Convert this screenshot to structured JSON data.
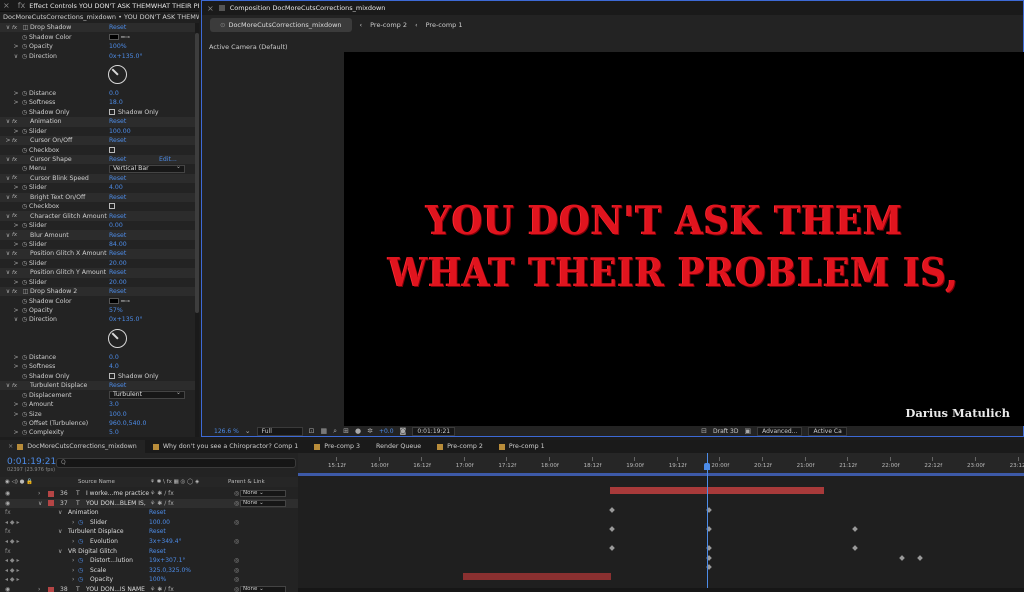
{
  "effect_controls": {
    "tab_title": "Effect Controls YOU DON'T ASK THEMWHAT THEIR PRC",
    "subtitle": "DocMoreCutsCorrections_mixdown • YOU DON'T ASK THEMWHAT THEIR PR",
    "reset": "Reset",
    "edit": "Edit...",
    "rows": [
      {
        "kind": "hdr",
        "tw": "∨",
        "fx": "fx",
        "sw": "◫",
        "name": "Drop Shadow",
        "value": "Reset"
      },
      {
        "kind": "prop",
        "sw": "◷",
        "name": "Shadow Color",
        "color": true
      },
      {
        "kind": "prop",
        "tw": ">",
        "sw": "◷",
        "name": "Opacity",
        "value": "100%"
      },
      {
        "kind": "prop",
        "tw": "∨",
        "sw": "◷",
        "name": "Direction",
        "value": "0x+135.0°"
      },
      {
        "kind": "dial"
      },
      {
        "kind": "prop",
        "tw": ">",
        "sw": "◷",
        "name": "Distance",
        "value": "0.0"
      },
      {
        "kind": "prop",
        "tw": ">",
        "sw": "◷",
        "name": "Softness",
        "value": "18.0"
      },
      {
        "kind": "prop",
        "sw": "◷",
        "name": "Shadow Only",
        "check": "Shadow Only"
      },
      {
        "kind": "hdr",
        "tw": "∨",
        "fx": "fx",
        "name": "Animation",
        "value": "Reset"
      },
      {
        "kind": "prop",
        "tw": ">",
        "sw": "◷",
        "name": "Slider",
        "value": "100.00"
      },
      {
        "kind": "hdr",
        "tw": ">",
        "fx": "fx",
        "name": "Cursor On/Off",
        "value": "Reset"
      },
      {
        "kind": "prop",
        "sw": "◷",
        "name": "Checkbox",
        "check": ""
      },
      {
        "kind": "hdr",
        "tw": "∨",
        "fx": "fx",
        "name": "Cursor Shape",
        "value": "Reset",
        "edit": true
      },
      {
        "kind": "prop",
        "sw": "◷",
        "name": "Menu",
        "drop": "Vertical Bar"
      },
      {
        "kind": "hdr",
        "tw": "∨",
        "fx": "fx",
        "name": "Cursor Blink Speed",
        "value": "Reset"
      },
      {
        "kind": "prop",
        "tw": ">",
        "sw": "◷",
        "name": "Slider",
        "value": "4.00"
      },
      {
        "kind": "hdr",
        "tw": "∨",
        "fx": "fx",
        "name": "Bright Text On/Off",
        "value": "Reset"
      },
      {
        "kind": "prop",
        "sw": "◷",
        "name": "Checkbox",
        "check": ""
      },
      {
        "kind": "hdr",
        "tw": "∨",
        "fx": "fx",
        "name": "Character Glitch Amount",
        "value": "Reset"
      },
      {
        "kind": "prop",
        "tw": ">",
        "sw": "◷",
        "name": "Slider",
        "value": "0.00"
      },
      {
        "kind": "hdr",
        "tw": "∨",
        "fx": "fx",
        "name": "Blur Amount",
        "value": "Reset"
      },
      {
        "kind": "prop",
        "tw": ">",
        "sw": "◷",
        "name": "Slider",
        "value": "84.00"
      },
      {
        "kind": "hdr",
        "tw": "∨",
        "fx": "fx",
        "name": "Position Glitch X Amount",
        "value": "Reset"
      },
      {
        "kind": "prop",
        "tw": ">",
        "sw": "◷",
        "name": "Slider",
        "value": "20.00"
      },
      {
        "kind": "hdr",
        "tw": "∨",
        "fx": "fx",
        "name": "Position Glitch Y Amount",
        "value": "Reset"
      },
      {
        "kind": "prop",
        "tw": ">",
        "sw": "◷",
        "name": "Slider",
        "value": "20.00"
      },
      {
        "kind": "hdr",
        "tw": "∨",
        "fx": "fx",
        "sw": "◫",
        "name": "Drop Shadow 2",
        "value": "Reset"
      },
      {
        "kind": "prop",
        "sw": "◷",
        "name": "Shadow Color",
        "color": true
      },
      {
        "kind": "prop",
        "tw": ">",
        "sw": "◷",
        "name": "Opacity",
        "value": "57%"
      },
      {
        "kind": "prop",
        "tw": "∨",
        "sw": "◷",
        "name": "Direction",
        "value": "0x+135.0°"
      },
      {
        "kind": "dial"
      },
      {
        "kind": "prop",
        "tw": ">",
        "sw": "◷",
        "name": "Distance",
        "value": "0.0"
      },
      {
        "kind": "prop",
        "tw": ">",
        "sw": "◷",
        "name": "Softness",
        "value": "4.0"
      },
      {
        "kind": "prop",
        "sw": "◷",
        "name": "Shadow Only",
        "check": "Shadow Only"
      },
      {
        "kind": "hdr",
        "tw": "∨",
        "fx": "fx",
        "name": "Turbulent Displace",
        "value": "Reset"
      },
      {
        "kind": "prop",
        "sw": "◷",
        "name": "Displacement",
        "drop": "Turbulent"
      },
      {
        "kind": "prop",
        "tw": ">",
        "sw": "◷",
        "name": "Amount",
        "value": "3.0"
      },
      {
        "kind": "prop",
        "tw": ">",
        "sw": "◷",
        "name": "Size",
        "value": "100.0"
      },
      {
        "kind": "prop",
        "sw": "◷",
        "name": "Offset (Turbulence)",
        "value": "960.0,540.0"
      },
      {
        "kind": "prop",
        "tw": ">",
        "sw": "◷",
        "name": "Complexity",
        "value": "5.0"
      },
      {
        "kind": "prop",
        "tw": "∨",
        "sw": "◷",
        "name": "Evolution",
        "value": "3x+349.4°"
      }
    ]
  },
  "composition": {
    "tab_title": "Composition DocMoreCutsCorrections_mixdown",
    "crumbs": [
      "DocMoreCutsCorrections_mixdown",
      "Pre-comp 2",
      "Pre-comp 1"
    ],
    "camera": "Active Camera (Default)",
    "line1": "YOU DON'T ASK THEM",
    "line2": "WHAT THEIR PROBLEM IS,",
    "signature": "Darius Matulich",
    "footer": {
      "zoom": "126.6 %",
      "resolution": "Full",
      "exposure": "+0.0",
      "timecode": "0:01:19:21",
      "renderer": "Draft 3D",
      "advanced": "Advanced...",
      "active_camera": "Active Ca"
    }
  },
  "timeline": {
    "tabs": [
      "DocMoreCutsCorrections_mixdown",
      "Why don't you see a Chiropractor? Comp 1",
      "Pre-comp 3",
      "Render Queue",
      "Pre-comp 2",
      "Pre-comp 1"
    ],
    "timecode": "0:01:19:21",
    "frames": "02397 (23.976 fps)",
    "search_placeholder": "Q",
    "col_source": "Source Name",
    "col_parent": "Parent & Link",
    "ruler": [
      "15:12f",
      "16:00f",
      "16:12f",
      "17:00f",
      "17:12f",
      "18:00f",
      "18:12f",
      "19:00f",
      "19:12f",
      "20:00f",
      "20:12f",
      "21:00f",
      "21:12f",
      "22:00f",
      "22:12f",
      "23:00f",
      "23:12f"
    ],
    "rows": [
      {
        "num": "36",
        "name": "I worke...me practice",
        "parent": "None",
        "color": "#b54545"
      },
      {
        "num": "37",
        "name": "YOU DON...BLEM IS,",
        "parent": "None",
        "color": "#b54545",
        "sel": true
      },
      {
        "indent": 1,
        "name": "Animation",
        "value": "Reset"
      },
      {
        "indent": 2,
        "name": "Slider",
        "value": "100.00"
      },
      {
        "indent": 1,
        "name": "Turbulent Displace",
        "value": "Reset"
      },
      {
        "indent": 2,
        "name": "Evolution",
        "value": "3x+349.4°"
      },
      {
        "indent": 1,
        "name": "VR Digital Glitch",
        "value": "Reset"
      },
      {
        "indent": 2,
        "name": "Distort...lution",
        "value": "19x+307.1°"
      },
      {
        "indent": 2,
        "name": "Scale",
        "value": "325.0,325.0%"
      },
      {
        "indent": 2,
        "name": "Opacity",
        "value": "100%"
      },
      {
        "num": "38",
        "name": "YOU DON...IS NAME",
        "parent": "None",
        "color": "#b54545"
      }
    ]
  }
}
